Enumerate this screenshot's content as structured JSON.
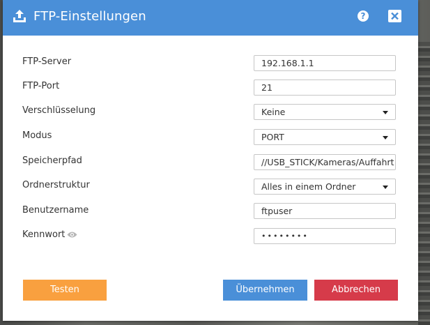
{
  "dialog": {
    "title": "FTP-Einstellungen",
    "icons": {
      "title": "upload-icon",
      "help": "help-icon",
      "close": "close-icon",
      "password_toggle": "eye-icon"
    },
    "help_glyph": "?"
  },
  "form": {
    "server": {
      "label": "FTP-Server",
      "value": "192.168.1.1"
    },
    "port": {
      "label": "FTP-Port",
      "value": "21"
    },
    "encryption": {
      "label": "Verschlüsselung",
      "value": "Keine"
    },
    "mode": {
      "label": "Modus",
      "value": "PORT"
    },
    "path": {
      "label": "Speicherpfad",
      "value": "//USB_STICK/Kameras/Auffahrt"
    },
    "folder_structure": {
      "label": "Ordnerstruktur",
      "value": "Alles in einem Ordner"
    },
    "username": {
      "label": "Benutzername",
      "value": "ftpuser"
    },
    "password": {
      "label": "Kennwort",
      "value": "••••••••"
    }
  },
  "buttons": {
    "test": "Testen",
    "apply": "Übernehmen",
    "cancel": "Abbrechen"
  },
  "colors": {
    "header": "#4a8fd8",
    "test": "#f9a03f",
    "apply": "#4a8fd8",
    "cancel": "#d63b4a"
  }
}
